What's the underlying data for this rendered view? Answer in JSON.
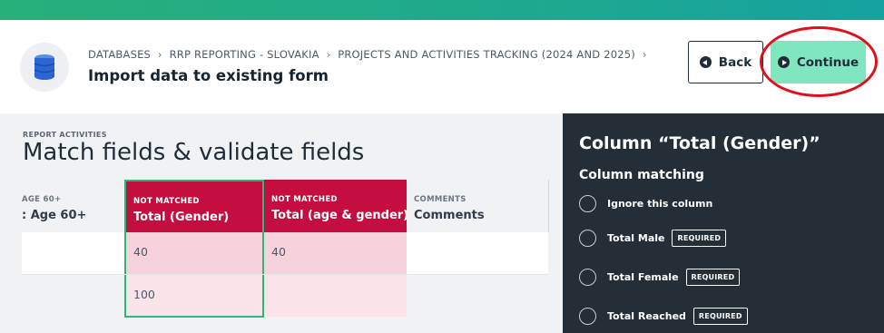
{
  "header": {
    "breadcrumb": [
      "DATABASES",
      "RRP REPORTING - SLOVAKIA",
      "PROJECTS AND ACTIVITIES TRACKING (2024 AND 2025)"
    ],
    "breadcrumb_separator": "›",
    "title": "Import data to existing form",
    "back_label": "Back",
    "continue_label": "Continue"
  },
  "main": {
    "section_label": "REPORT ACTIVITIES",
    "section_title": "Match fields & validate fields",
    "columns": [
      {
        "status": "AGE 60+",
        "name": ": Age 60+"
      },
      {
        "status": "NOT MATCHED",
        "name": "Total (Gender)"
      },
      {
        "status": "NOT MATCHED",
        "name": "Total (age & gender)"
      },
      {
        "status": "COMMENTS",
        "name": "Comments"
      }
    ],
    "rows": [
      [
        "",
        "40",
        "40",
        ""
      ],
      [
        "",
        "100",
        "",
        ""
      ]
    ]
  },
  "panel": {
    "title": "Column “Total (Gender)”",
    "subtitle": "Column matching",
    "options": [
      {
        "label": "Ignore this column",
        "badge": ""
      },
      {
        "label": "Total Male",
        "badge": "REQUIRED"
      },
      {
        "label": "Total Female",
        "badge": "REQUIRED"
      },
      {
        "label": "Total Reached",
        "badge": "REQUIRED"
      }
    ]
  },
  "colors": {
    "accent_green": "#27b87a",
    "not_matched_red": "#c40e40",
    "continue_bg": "#7fe6bf",
    "panel_bg": "#232e36"
  }
}
